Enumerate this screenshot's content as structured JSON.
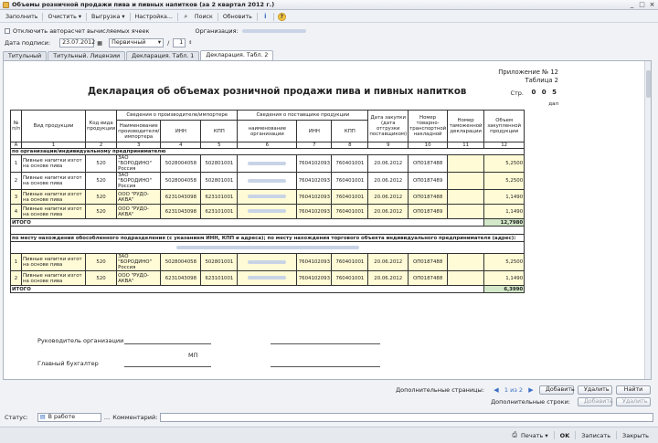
{
  "window": {
    "title": "Объемы розничной продажи пива и пивных напитков (за 2 квартал 2012 г.)",
    "btn_min": "_",
    "btn_max": "□",
    "btn_close": "×"
  },
  "toolbar": {
    "fill": "Заполнить",
    "clear": "Очистить ▾",
    "export": "Выгрузка ▾",
    "settings": "Настройка...",
    "search": "Поиск",
    "refresh": "Обновить"
  },
  "form": {
    "autocalc_label": "Отключить авторасчет вычисляемых ячеек",
    "org_label": "Организация:",
    "date_label": "Дата подписи:",
    "date_value": "23.07.2012",
    "type_value": "Первичный",
    "slash": "/",
    "correction_num": "1"
  },
  "tabs": [
    "Титульный",
    "Титульный. Лицензии",
    "Декларация. Табл. 1",
    "Декларация. Табл. 2"
  ],
  "doc": {
    "appendix": "Приложение № 12",
    "table_no": "Таблица 2",
    "title": "Декларация об объемах розничной продажи пива и пивных напитков",
    "page_label": "Стр.",
    "page_num": "0 0 5",
    "unit": "дал"
  },
  "headers": {
    "n": "№ п/п",
    "product": "Вид продукции",
    "code": "Код вида продукции",
    "producer": "Сведения о производителе/импортере",
    "producer_name": "Наименование производителя/ импортера",
    "inn": "ИНН",
    "kpp": "КПП",
    "supplier": "Сведения о поставщике продукции",
    "supplier_name": "наименование организации",
    "purchase_date": "Дата закупки (дата отгрузки поставщиком)",
    "ttn": "Номер товарно-транспортной накладной",
    "customs": "Номер таможенной декларации",
    "volume": "Объем закупленной продукции",
    "col_nums": [
      "А",
      "1",
      "2",
      "3",
      "4",
      "5",
      "6",
      "7",
      "8",
      "9",
      "10",
      "11",
      "12"
    ]
  },
  "section1": {
    "title": "по организации/индивидуальному предпринимателю",
    "rows": [
      {
        "n": "1",
        "product": "Пивные напитки изгот на основе пива",
        "code": "520",
        "producer": "ЗАО \"БОРОДИНО\" Россия",
        "inn": "5028004058",
        "kpp": "502801001",
        "s_inn": "7604102093",
        "s_kpp": "760401001",
        "date": "20.06.2012",
        "ttn": "ОП0187488",
        "customs": "",
        "volume": "5,2500"
      },
      {
        "n": "2",
        "product": "Пивные напитки изгот на основе пива",
        "code": "520",
        "producer": "ЗАО \"БОРОДИНО\" Россия",
        "inn": "5028004058",
        "kpp": "502801001",
        "s_inn": "7604102093",
        "s_kpp": "760401001",
        "date": "20.06.2012",
        "ttn": "ОП0187489",
        "customs": "",
        "volume": "5,2500"
      },
      {
        "n": "3",
        "product": "Пивные напитки изгот на основе пива",
        "code": "520",
        "producer": "ООО \"РУДО-АКВА\"",
        "inn": "6231043098",
        "kpp": "623101001",
        "s_inn": "7604102093",
        "s_kpp": "760401001",
        "date": "20.06.2012",
        "ttn": "ОП0187488",
        "customs": "",
        "volume": "1,1490"
      },
      {
        "n": "4",
        "product": "Пивные напитки изгот на основе пива",
        "code": "520",
        "producer": "ООО \"РУДО-АКВА\"",
        "inn": "6231043098",
        "kpp": "623101001",
        "s_inn": "7604102093",
        "s_kpp": "760401001",
        "date": "20.06.2012",
        "ttn": "ОП0187489",
        "customs": "",
        "volume": "1,1490"
      }
    ],
    "total_label": "ИТОГО",
    "total": "12,7980"
  },
  "section2": {
    "title": "по месту нахождения обособленного подразделения (с указанием ИНН, КПП и адреса); по месту нахождения торгового объекта индивидуального предпринимателя (адрес):",
    "rows": [
      {
        "n": "1",
        "product": "Пивные напитки изгот на основе пива",
        "code": "520",
        "producer": "ЗАО \"БОРОДИНО\" Россия",
        "inn": "5028004058",
        "kpp": "502801001",
        "s_inn": "7604102093",
        "s_kpp": "760401001",
        "date": "20.06.2012",
        "ttn": "ОП0187488",
        "customs": "",
        "volume": "5,2500"
      },
      {
        "n": "2",
        "product": "Пивные напитки изгот на основе пива",
        "code": "520",
        "producer": "ООО \"РУДО-АКВА\"",
        "inn": "6231043098",
        "kpp": "623101001",
        "s_inn": "7604102093",
        "s_kpp": "760401001",
        "date": "20.06.2012",
        "ttn": "ОП0187488",
        "customs": "",
        "volume": "1,1490"
      }
    ],
    "total_label": "ИТОГО",
    "total": "6,3990"
  },
  "signatures": {
    "head": "Руководитель организации",
    "mp": "МП",
    "accountant": "Главный бухгалтер"
  },
  "pager": {
    "extra_pages_label": "Дополнительные страницы:",
    "page_info": "1 из 2",
    "add": "Добавить",
    "delete": "Удалить",
    "find": "Найти",
    "extra_rows_label": "Дополнительные строки:",
    "add_row": "Добавить",
    "delete_row": "Удалить"
  },
  "status": {
    "label": "Статус:",
    "value": "В работе",
    "comment_label": "Комментарий:"
  },
  "bottom": {
    "print": "Печать ▾",
    "ok": "OK",
    "save": "Записать",
    "close": "Закрыть"
  },
  "colors": {
    "row_fill": "#fffbd6",
    "total_fill": "#d3e8c8",
    "accent": "#3a6fc4"
  }
}
